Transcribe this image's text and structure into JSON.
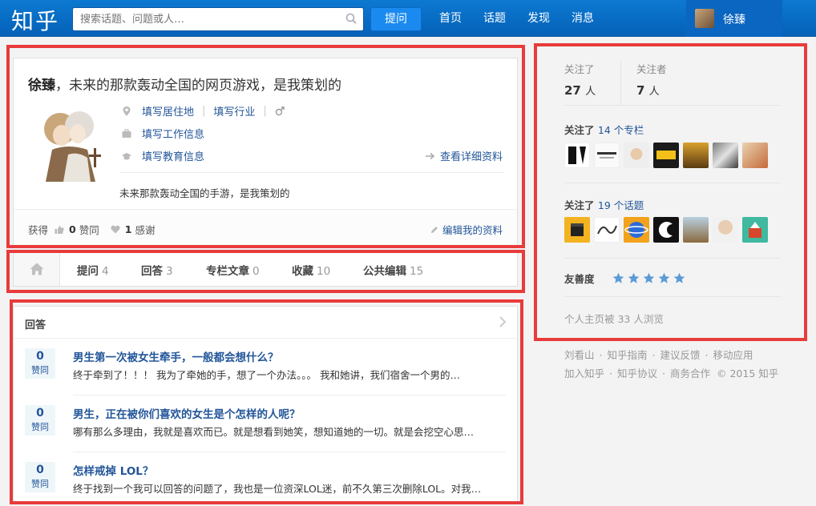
{
  "header": {
    "logo": "知乎",
    "search_placeholder": "搜索话题、问题或人…",
    "ask_label": "提问",
    "nav": [
      "首页",
      "话题",
      "发现",
      "消息"
    ],
    "username": "徐臻"
  },
  "profile": {
    "name": "徐臻",
    "headline": "，未来的那款轰动全国的网页游戏，是我策划的",
    "location": "填写居住地",
    "industry": "填写行业",
    "gender_icon": "male-icon",
    "work": "填写工作信息",
    "education": "填写教育信息",
    "detail_link": "查看详细资料",
    "description": "未来那款轰动全国的手游，是我策划的",
    "gained_label": "获得",
    "agrees": "0",
    "agrees_label": "赞同",
    "thanks": "1",
    "thanks_label": "感谢",
    "edit_label": "编辑我的资料"
  },
  "tabs": [
    {
      "label": "提问",
      "count": "4"
    },
    {
      "label": "回答",
      "count": "3"
    },
    {
      "label": "专栏文章",
      "count": "0"
    },
    {
      "label": "收藏",
      "count": "10"
    },
    {
      "label": "公共编辑",
      "count": "15"
    }
  ],
  "answers": {
    "title": "回答",
    "items": [
      {
        "votes": "0",
        "vote_label": "赞同",
        "question": "男生第一次被女生牵手，一般都会想什么？",
        "snippet": "终于牵到了！！！ 我为了牵她的手，想了一个办法。。。 我和她讲，我们宿舍一个男的…"
      },
      {
        "votes": "0",
        "vote_label": "赞同",
        "question": "男生，正在被你们喜欢的女生是个怎样的人呢？",
        "snippet": "哪有那么多理由，我就是喜欢而已。就是想看到她笑，想知道她的一切。就是会挖空心思…"
      },
      {
        "votes": "0",
        "vote_label": "赞同",
        "question": "怎样戒掉 LOL？",
        "snippet": "终于找到一个我可以回答的问题了，我也是一位资深LOL迷，前不久第三次删除LOL。对我…"
      }
    ]
  },
  "sidebar": {
    "following_label": "关注了",
    "following_count": "27",
    "followers_label": "关注者",
    "followers_count": "7",
    "unit": "人",
    "columns_prefix": "关注了",
    "columns_link": "14 个专栏",
    "topics_prefix": "关注了",
    "topics_link": "19 个话题",
    "friendly_label": "友善度",
    "friendly_stars": 5,
    "views": "个人主页被 33 人浏览"
  },
  "footer": {
    "line1": [
      "刘看山",
      "知乎指南",
      "建议反馈",
      "移动应用"
    ],
    "line2": [
      "加入知乎",
      "知乎协议",
      "商务合作"
    ],
    "copyright": "© 2015 知乎"
  },
  "colors": {
    "brand": "#0f7fd6",
    "link": "#225599",
    "annotation": "#e83b3b"
  }
}
